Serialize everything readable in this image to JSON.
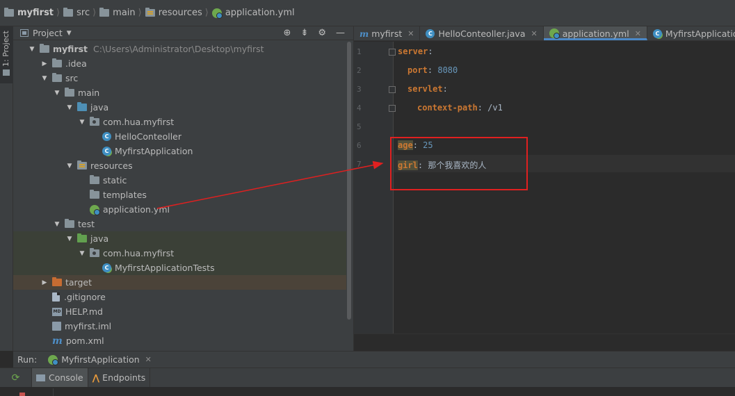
{
  "breadcrumb": [
    "myfirst",
    "src",
    "main",
    "resources",
    "application.yml"
  ],
  "sidebar_tab": "1: Project",
  "project_panel": {
    "title": "Project",
    "tree": [
      {
        "label": "myfirst",
        "extra": "C:\\Users\\Administrator\\Desktop\\myfirst",
        "depth": 0,
        "arrow": "down",
        "icon": "folder-icon",
        "bold": true
      },
      {
        "label": ".idea",
        "depth": 1,
        "arrow": "right",
        "icon": "folder-icon"
      },
      {
        "label": "src",
        "depth": 1,
        "arrow": "down",
        "icon": "folder-icon"
      },
      {
        "label": "main",
        "depth": 2,
        "arrow": "down",
        "icon": "folder-icon"
      },
      {
        "label": "java",
        "depth": 3,
        "arrow": "down",
        "icon": "source-folder-icon"
      },
      {
        "label": "com.hua.myfirst",
        "depth": 4,
        "arrow": "down",
        "icon": "package-icon"
      },
      {
        "label": "HelloConteoller",
        "depth": 5,
        "arrow": "",
        "icon": "class-icon"
      },
      {
        "label": "MyfirstApplication",
        "depth": 5,
        "arrow": "",
        "icon": "spring-class-icon"
      },
      {
        "label": "resources",
        "depth": 3,
        "arrow": "down",
        "icon": "resources-folder-icon"
      },
      {
        "label": "static",
        "depth": 4,
        "arrow": "",
        "icon": "folder-icon"
      },
      {
        "label": "templates",
        "depth": 4,
        "arrow": "",
        "icon": "folder-icon"
      },
      {
        "label": "application.yml",
        "depth": 4,
        "arrow": "",
        "icon": "spring-yml-icon"
      },
      {
        "label": "test",
        "depth": 2,
        "arrow": "down",
        "icon": "folder-icon"
      },
      {
        "label": "java",
        "depth": 3,
        "arrow": "down",
        "icon": "test-folder-icon"
      },
      {
        "label": "com.hua.myfirst",
        "depth": 4,
        "arrow": "down",
        "icon": "package-icon"
      },
      {
        "label": "MyfirstApplicationTests",
        "depth": 5,
        "arrow": "",
        "icon": "spring-class-icon"
      },
      {
        "label": "target",
        "depth": 1,
        "arrow": "right",
        "icon": "excluded-folder-icon"
      },
      {
        "label": ".gitignore",
        "depth": 1,
        "arrow": "",
        "icon": "file-icon"
      },
      {
        "label": "HELP.md",
        "depth": 1,
        "arrow": "",
        "icon": "markdown-icon"
      },
      {
        "label": "myfirst.iml",
        "depth": 1,
        "arrow": "",
        "icon": "iml-icon"
      },
      {
        "label": "pom.xml",
        "depth": 1,
        "arrow": "",
        "icon": "maven-icon"
      }
    ]
  },
  "editor": {
    "tabs": [
      {
        "label": "myfirst",
        "icon": "maven-icon",
        "active": false
      },
      {
        "label": "HelloConteoller.java",
        "icon": "class-icon",
        "active": false
      },
      {
        "label": "application.yml",
        "icon": "spring-yml-icon",
        "active": true
      },
      {
        "label": "MyfirstApplication.java",
        "icon": "spring-class-icon",
        "active": false
      }
    ],
    "lines": [
      {
        "num": "1",
        "key": "server",
        "sep": ":",
        "value": ""
      },
      {
        "num": "2",
        "key": "port",
        "sep": ": ",
        "value": "8080"
      },
      {
        "num": "3",
        "key": "servlet",
        "sep": ":",
        "value": ""
      },
      {
        "num": "4",
        "key": "context-path",
        "sep": ": ",
        "value": "/v1"
      },
      {
        "num": "5",
        "key": "",
        "sep": "",
        "value": ""
      },
      {
        "num": "6",
        "key": "age",
        "sep": ": ",
        "value": "25"
      },
      {
        "num": "7",
        "key": "girl",
        "sep": ": ",
        "value": "那个我喜欢的人"
      }
    ]
  },
  "run": {
    "label": "Run:",
    "config": "MyfirstApplication",
    "tabs": [
      "Console",
      "Endpoints"
    ]
  },
  "colors": {
    "annotation": "#e02020",
    "yaml_key": "#cc7832",
    "yaml_number": "#6897bb"
  }
}
